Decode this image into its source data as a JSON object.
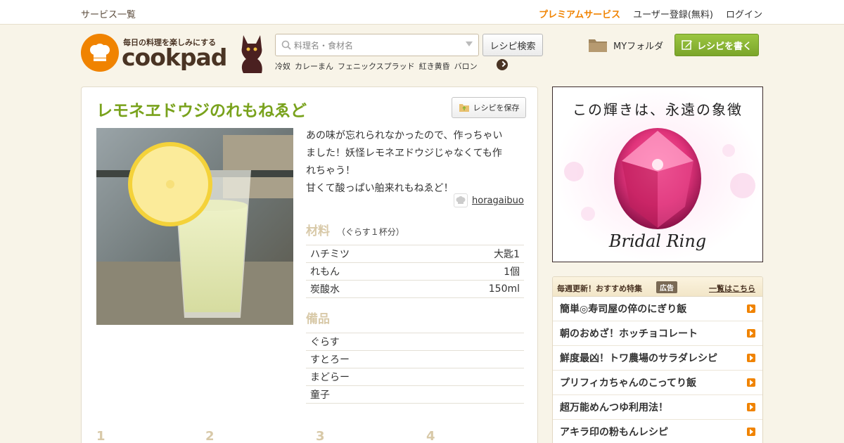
{
  "topbar": {
    "services": "サービス一覧",
    "premium": "プレミアムサービス",
    "register": "ユーザー登録(無料)",
    "login": "ログイン"
  },
  "header": {
    "tagline": "毎日の料理を楽しみにする",
    "logo_word": "cookpad",
    "search_placeholder": "料理名・食材名",
    "search_button": "レシピ検索",
    "keywords": [
      "冷奴",
      "カレーまん",
      "フェニックスプラッド",
      "紅き黄昏",
      "バロン"
    ],
    "my_folder": "MYフォルダ",
    "write_recipe": "レシピを書く"
  },
  "recipe": {
    "title": "レモネヱドウジのれもねゑど",
    "save_button": "レシピを保存",
    "description": [
      "あの味が忘れられなかったので、作っちゃい",
      "ました！妖怪レモネヱドウジじゃなくても作",
      "れちゃう！",
      "甘くて酸っぱい舶来れもねゑど！"
    ],
    "author": "horagaibuo",
    "ingredients_heading": "材料",
    "servings": "（ぐらす１杯分）",
    "ingredients": [
      {
        "name": "ハチミツ",
        "amount": "大匙1"
      },
      {
        "name": "れもん",
        "amount": "1個"
      },
      {
        "name": "炭酸水",
        "amount": "150ml"
      }
    ],
    "tools_heading": "備品",
    "tools": [
      "ぐらす",
      "すとろー",
      "まどらー",
      "童子"
    ],
    "steps": [
      "1",
      "2",
      "3",
      "4"
    ]
  },
  "ad": {
    "headline": "この輝きは、永遠の象徴",
    "product": "Bridal Ring"
  },
  "feature": {
    "heading": "毎週更新！おすすめ特集",
    "badge": "広告",
    "more": "一覧はこちら",
    "items": [
      "簡単◎寿司屋の倅のにぎり飯",
      "朝のおめざ！ホッチョコレート",
      "鮮度最凶！トワ農場のサラダレシピ",
      "プリフィカちゃんのこってり飯",
      "超万能めんつゆ利用法！",
      "アキラ印の粉もんレシピ"
    ]
  },
  "colors": {
    "brand_orange": "#f08300",
    "title_green": "#79a21c",
    "button_green": "#8cb737",
    "brown": "#4a3424"
  }
}
